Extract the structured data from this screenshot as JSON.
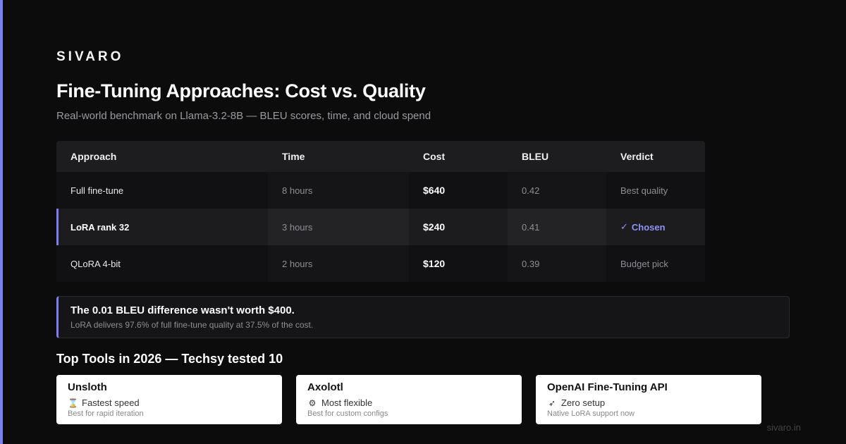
{
  "brand": "SIVARO",
  "title": "Fine-Tuning Approaches: Cost vs. Quality",
  "subtitle": "Real-world benchmark on Llama-3.2-8B — BLEU scores, time, and cloud spend",
  "table": {
    "headers": [
      "Approach",
      "Time",
      "Cost",
      "BLEU",
      "Verdict"
    ],
    "rows": [
      {
        "approach": "Full fine-tune",
        "time": "8 hours",
        "cost": "$640",
        "bleu": "0.42",
        "verdict": "Best quality"
      },
      {
        "approach": "LoRA rank 32",
        "time": "3 hours",
        "cost": "$240",
        "bleu": "0.41",
        "verdict": "Chosen",
        "verdict_icon": "✓"
      },
      {
        "approach": "QLoRA 4-bit",
        "time": "2 hours",
        "cost": "$120",
        "bleu": "0.39",
        "verdict": "Budget pick"
      }
    ]
  },
  "callout": {
    "title": "The 0.01 BLEU difference wasn't worth $400.",
    "body": "LoRA delivers 97.6% of full fine-tune quality at 37.5% of the cost."
  },
  "tools_heading": "Top Tools in 2026 — Techsy tested 10",
  "tools": [
    {
      "name": "Unsloth",
      "icon": "hourglass-icon",
      "feature": "Fastest speed",
      "note": "Best for rapid iteration"
    },
    {
      "name": "Axolotl",
      "icon": "gear-icon",
      "feature": "Most flexible",
      "note": "Best for custom configs"
    },
    {
      "name": "OpenAI Fine-Tuning API",
      "icon": "rocket-icon",
      "feature": "Zero setup",
      "note": "Native LoRA support now"
    }
  ],
  "footer": "sivaro.in",
  "colors": {
    "accent": "#7b7ff0",
    "background": "#0c0c0d"
  }
}
